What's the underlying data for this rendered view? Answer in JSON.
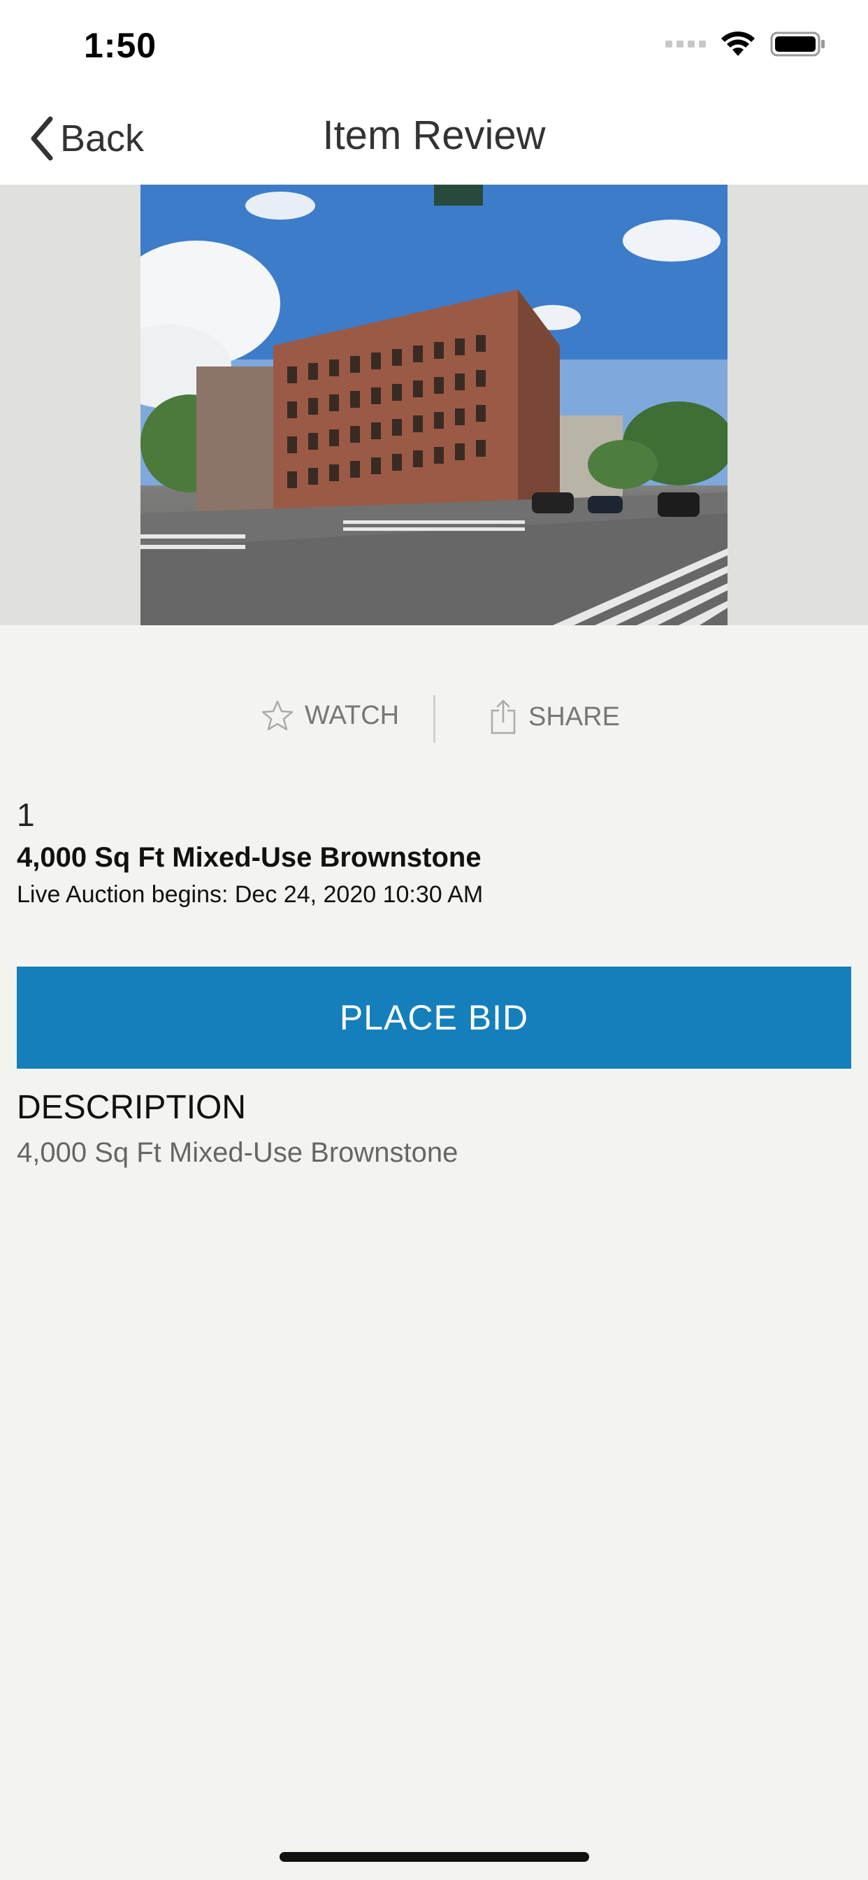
{
  "status_bar": {
    "time": "1:50"
  },
  "nav": {
    "back_label": "Back",
    "title": "Item Review"
  },
  "hero": {
    "image_name": "brownstone-building-photo"
  },
  "actions": {
    "watch_label": "WATCH",
    "share_label": "SHARE"
  },
  "item": {
    "lot_number": "1",
    "title": "4,000 Sq Ft Mixed-Use Brownstone",
    "auction_info": "Live Auction begins: Dec 24, 2020 10:30 AM"
  },
  "bid": {
    "button_label": "PLACE BID",
    "color": "#147fbb"
  },
  "description": {
    "heading": "DESCRIPTION",
    "text": "4,000 Sq Ft Mixed-Use Brownstone"
  }
}
